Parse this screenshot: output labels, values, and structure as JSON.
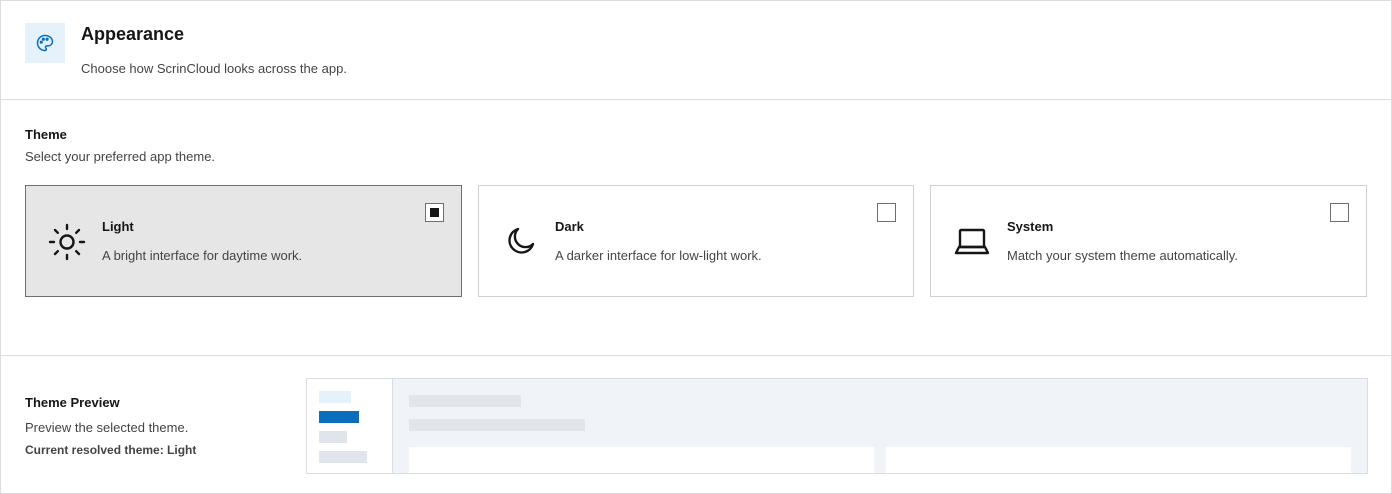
{
  "header": {
    "icon": "palette-icon",
    "title": "Appearance",
    "subtitle": "Choose how ScrinCloud looks across the app."
  },
  "theme": {
    "title": "Theme",
    "description": "Select your preferred app theme.",
    "options": [
      {
        "label": "Light",
        "description": "A bright interface for daytime work.",
        "icon": "sun-icon",
        "selected": true
      },
      {
        "label": "Dark",
        "description": "A darker interface for low-light work.",
        "icon": "moon-icon",
        "selected": false
      },
      {
        "label": "System",
        "description": "Match your system theme automatically.",
        "icon": "laptop-icon",
        "selected": false
      }
    ]
  },
  "preview": {
    "title": "Theme Preview",
    "description": "Preview the selected theme.",
    "current": "Current resolved theme: Light"
  },
  "colors": {
    "accent": "#0f62fe",
    "brand_blue": "#0a6ebd",
    "icon_bg": "#e5f2fb",
    "selected_bg": "#e6e6e6"
  }
}
